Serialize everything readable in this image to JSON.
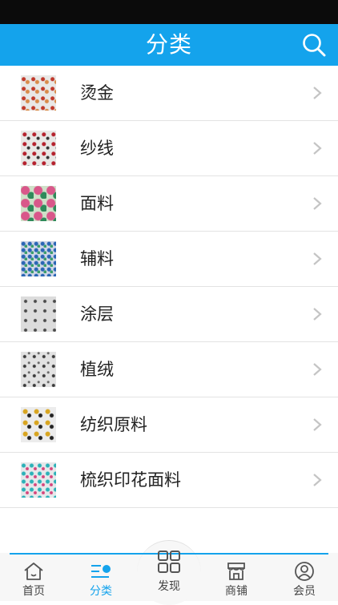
{
  "header": {
    "title": "分类",
    "search_icon": "search-icon"
  },
  "categories": [
    {
      "label": "烫金",
      "thumb": "fabric-thumbnail"
    },
    {
      "label": "纱线",
      "thumb": "fabric-thumbnail"
    },
    {
      "label": "面料",
      "thumb": "fabric-thumbnail"
    },
    {
      "label": "辅料",
      "thumb": "fabric-thumbnail"
    },
    {
      "label": "涂层",
      "thumb": "fabric-thumbnail"
    },
    {
      "label": "植绒",
      "thumb": "fabric-thumbnail"
    },
    {
      "label": "纺织原料",
      "thumb": "fabric-thumbnail"
    },
    {
      "label": "梳织印花面料",
      "thumb": "fabric-thumbnail"
    }
  ],
  "tabbar": {
    "tabs": [
      {
        "label": "首页",
        "icon": "home-icon",
        "active": false
      },
      {
        "label": "分类",
        "icon": "category-icon",
        "active": true
      },
      {
        "label": "发现",
        "icon": "grid-icon",
        "active": false
      },
      {
        "label": "商铺",
        "icon": "shop-icon",
        "active": false
      },
      {
        "label": "会员",
        "icon": "user-icon",
        "active": false
      }
    ]
  },
  "colors": {
    "accent": "#14a3ec",
    "status_bar": "#0b0b0b",
    "chevron": "#c4c4c4"
  }
}
